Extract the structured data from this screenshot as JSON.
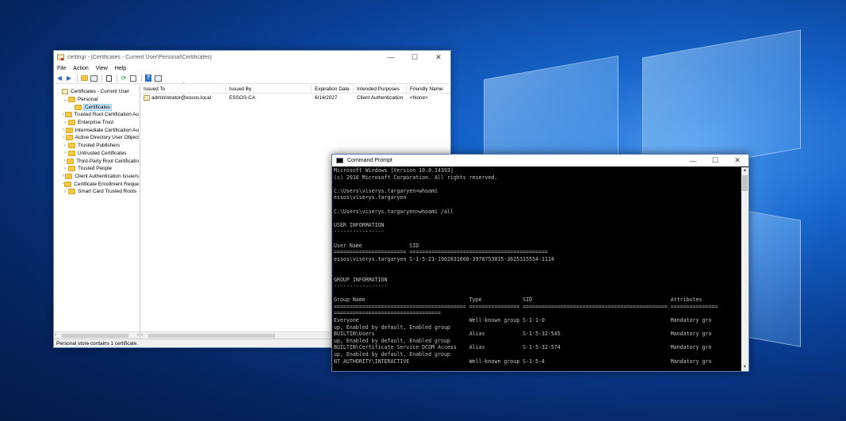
{
  "certmgr": {
    "title": "certmgr - [Certificates - Current User\\Personal\\Certificates]",
    "menu": [
      "File",
      "Action",
      "View",
      "Help"
    ],
    "tree": [
      {
        "label": "Certificates - Current User",
        "level": 0,
        "expander": "",
        "folder": false
      },
      {
        "label": "Personal",
        "level": 1,
        "expander": "⌄",
        "folder": true
      },
      {
        "label": "Certificates",
        "level": 2,
        "expander": "",
        "folder": true,
        "selected": true
      },
      {
        "label": "Trusted Root Certification Au",
        "level": 1,
        "expander": "›",
        "folder": true
      },
      {
        "label": "Enterprise Trust",
        "level": 1,
        "expander": "›",
        "folder": true
      },
      {
        "label": "Intermediate Certification Au",
        "level": 1,
        "expander": "›",
        "folder": true
      },
      {
        "label": "Active Directory User Object",
        "level": 1,
        "expander": "›",
        "folder": true
      },
      {
        "label": "Trusted Publishers",
        "level": 1,
        "expander": "›",
        "folder": true
      },
      {
        "label": "Untrusted Certificates",
        "level": 1,
        "expander": "›",
        "folder": true
      },
      {
        "label": "Third-Party Root Certificatio",
        "level": 1,
        "expander": "›",
        "folder": true
      },
      {
        "label": "Trusted People",
        "level": 1,
        "expander": "›",
        "folder": true
      },
      {
        "label": "Client Authentication Issuers",
        "level": 1,
        "expander": "›",
        "folder": true
      },
      {
        "label": "Certificate Enrollment Reque",
        "level": 1,
        "expander": "›",
        "folder": true
      },
      {
        "label": "Smart Card Trusted Roots",
        "level": 1,
        "expander": "›",
        "folder": true
      }
    ],
    "columns": [
      "Issued To",
      "Issued By",
      "Expiration Date",
      "Intended Purposes",
      "Friendly Name"
    ],
    "rows": [
      [
        "administrator@essos.local",
        "ESSOS-CA",
        "6/14/2027",
        "Client Authentication",
        "<None>"
      ]
    ],
    "status": "Personal store contains 1 certificate."
  },
  "cmd": {
    "title": "Command Prompt",
    "lines": [
      "Microsoft Windows [Version 10.0.14393]",
      "(c) 2016 Microsoft Corporation. All rights reserved.",
      "",
      "C:\\Users\\viserys.targaryen>whoami",
      "essos\\viserys.targaryen",
      "",
      "C:\\Users\\viserys.targaryen>whoami /all",
      "",
      "USER INFORMATION",
      "----------------",
      "",
      "User Name               SID",
      "======================= ============================================",
      "essos\\viserys.targaryen S-1-5-21-1902831608-3978753035-3625315554-1114",
      "",
      "",
      "GROUP INFORMATION",
      "-----------------",
      "",
      "Group Name                                 Type             SID                                            Attributes",
      "========================================== ================ ============================================== ===============",
      "==================================",
      "Everyone                                   Well-known group S-1-1-0                                        Mandatory gro",
      "up, Enabled by default, Enabled group",
      "BUILTIN\\Users                              Alias            S-1-5-32-545                                   Mandatory gro",
      "up, Enabled by default, Enabled group",
      "BUILTIN\\Certificate Service DCOM Access    Alias            S-1-5-32-574                                   Mandatory gro",
      "up, Enabled by default, Enabled group",
      "NT AUTHORITY\\INTERACTIVE                   Well-known group S-1-5-4                                        Mandatory gro"
    ]
  }
}
